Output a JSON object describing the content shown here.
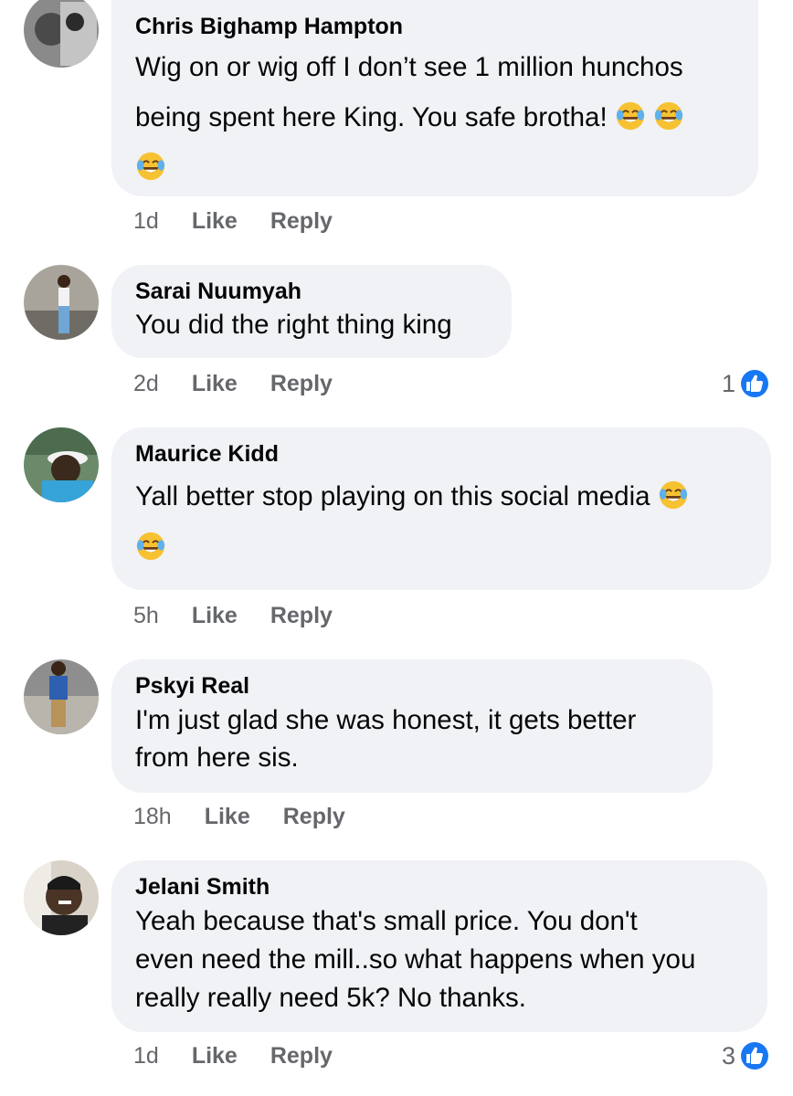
{
  "comments": [
    {
      "author": "Chris Bighamp Hampton",
      "lines": [
        "Wig on or wig off I don’t see 1 million hunchos",
        "being spent here King. You safe brotha! "
      ],
      "time": "1d",
      "like_label": "Like",
      "reply_label": "Reply",
      "reaction_count": ""
    },
    {
      "author": "Sarai Nuumyah",
      "lines": [
        "You did the right thing king"
      ],
      "time": "2d",
      "like_label": "Like",
      "reply_label": "Reply",
      "reaction_count": "1"
    },
    {
      "author": "Maurice Kidd",
      "lines": [
        "Yall better stop playing on this social media "
      ],
      "time": "5h",
      "like_label": "Like",
      "reply_label": "Reply",
      "reaction_count": ""
    },
    {
      "author": "Pskyi Real",
      "lines": [
        "I'm just glad she was honest, it gets better",
        "from here sis."
      ],
      "time": "18h",
      "like_label": "Like",
      "reply_label": "Reply",
      "reaction_count": ""
    },
    {
      "author": "Jelani Smith",
      "lines": [
        "Yeah because that's small price. You don't",
        "even need the mill..so what happens when you",
        "really really need 5k? No thanks."
      ],
      "time": "1d",
      "like_label": "Like",
      "reply_label": "Reply",
      "reaction_count": "3"
    }
  ],
  "icons": {
    "emoji": "face-with-tears-of-joy-icon",
    "reaction": "like-reaction-icon"
  },
  "colors": {
    "bubble": "#f0f2f5",
    "meta": "#65676b",
    "like_blue": "#1877f2",
    "emoji_yellow": "#f7c232"
  }
}
